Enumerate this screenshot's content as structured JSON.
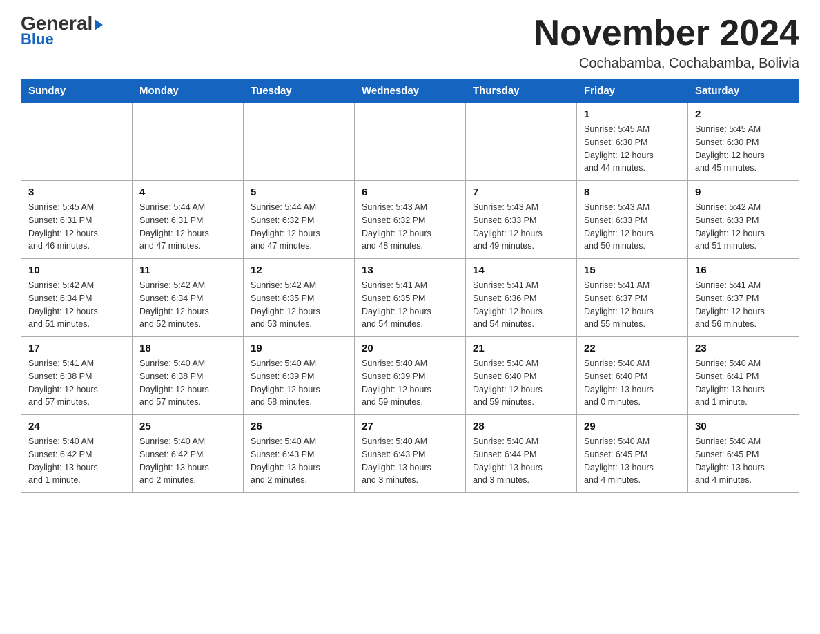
{
  "logo": {
    "general": "General",
    "blue_text": "Blue",
    "triangle": "▶"
  },
  "header": {
    "title": "November 2024",
    "subtitle": "Cochabamba, Cochabamba, Bolivia"
  },
  "weekdays": [
    "Sunday",
    "Monday",
    "Tuesday",
    "Wednesday",
    "Thursday",
    "Friday",
    "Saturday"
  ],
  "weeks": [
    [
      {
        "day": "",
        "info": ""
      },
      {
        "day": "",
        "info": ""
      },
      {
        "day": "",
        "info": ""
      },
      {
        "day": "",
        "info": ""
      },
      {
        "day": "",
        "info": ""
      },
      {
        "day": "1",
        "info": "Sunrise: 5:45 AM\nSunset: 6:30 PM\nDaylight: 12 hours\nand 44 minutes."
      },
      {
        "day": "2",
        "info": "Sunrise: 5:45 AM\nSunset: 6:30 PM\nDaylight: 12 hours\nand 45 minutes."
      }
    ],
    [
      {
        "day": "3",
        "info": "Sunrise: 5:45 AM\nSunset: 6:31 PM\nDaylight: 12 hours\nand 46 minutes."
      },
      {
        "day": "4",
        "info": "Sunrise: 5:44 AM\nSunset: 6:31 PM\nDaylight: 12 hours\nand 47 minutes."
      },
      {
        "day": "5",
        "info": "Sunrise: 5:44 AM\nSunset: 6:32 PM\nDaylight: 12 hours\nand 47 minutes."
      },
      {
        "day": "6",
        "info": "Sunrise: 5:43 AM\nSunset: 6:32 PM\nDaylight: 12 hours\nand 48 minutes."
      },
      {
        "day": "7",
        "info": "Sunrise: 5:43 AM\nSunset: 6:33 PM\nDaylight: 12 hours\nand 49 minutes."
      },
      {
        "day": "8",
        "info": "Sunrise: 5:43 AM\nSunset: 6:33 PM\nDaylight: 12 hours\nand 50 minutes."
      },
      {
        "day": "9",
        "info": "Sunrise: 5:42 AM\nSunset: 6:33 PM\nDaylight: 12 hours\nand 51 minutes."
      }
    ],
    [
      {
        "day": "10",
        "info": "Sunrise: 5:42 AM\nSunset: 6:34 PM\nDaylight: 12 hours\nand 51 minutes."
      },
      {
        "day": "11",
        "info": "Sunrise: 5:42 AM\nSunset: 6:34 PM\nDaylight: 12 hours\nand 52 minutes."
      },
      {
        "day": "12",
        "info": "Sunrise: 5:42 AM\nSunset: 6:35 PM\nDaylight: 12 hours\nand 53 minutes."
      },
      {
        "day": "13",
        "info": "Sunrise: 5:41 AM\nSunset: 6:35 PM\nDaylight: 12 hours\nand 54 minutes."
      },
      {
        "day": "14",
        "info": "Sunrise: 5:41 AM\nSunset: 6:36 PM\nDaylight: 12 hours\nand 54 minutes."
      },
      {
        "day": "15",
        "info": "Sunrise: 5:41 AM\nSunset: 6:37 PM\nDaylight: 12 hours\nand 55 minutes."
      },
      {
        "day": "16",
        "info": "Sunrise: 5:41 AM\nSunset: 6:37 PM\nDaylight: 12 hours\nand 56 minutes."
      }
    ],
    [
      {
        "day": "17",
        "info": "Sunrise: 5:41 AM\nSunset: 6:38 PM\nDaylight: 12 hours\nand 57 minutes."
      },
      {
        "day": "18",
        "info": "Sunrise: 5:40 AM\nSunset: 6:38 PM\nDaylight: 12 hours\nand 57 minutes."
      },
      {
        "day": "19",
        "info": "Sunrise: 5:40 AM\nSunset: 6:39 PM\nDaylight: 12 hours\nand 58 minutes."
      },
      {
        "day": "20",
        "info": "Sunrise: 5:40 AM\nSunset: 6:39 PM\nDaylight: 12 hours\nand 59 minutes."
      },
      {
        "day": "21",
        "info": "Sunrise: 5:40 AM\nSunset: 6:40 PM\nDaylight: 12 hours\nand 59 minutes."
      },
      {
        "day": "22",
        "info": "Sunrise: 5:40 AM\nSunset: 6:40 PM\nDaylight: 13 hours\nand 0 minutes."
      },
      {
        "day": "23",
        "info": "Sunrise: 5:40 AM\nSunset: 6:41 PM\nDaylight: 13 hours\nand 1 minute."
      }
    ],
    [
      {
        "day": "24",
        "info": "Sunrise: 5:40 AM\nSunset: 6:42 PM\nDaylight: 13 hours\nand 1 minute."
      },
      {
        "day": "25",
        "info": "Sunrise: 5:40 AM\nSunset: 6:42 PM\nDaylight: 13 hours\nand 2 minutes."
      },
      {
        "day": "26",
        "info": "Sunrise: 5:40 AM\nSunset: 6:43 PM\nDaylight: 13 hours\nand 2 minutes."
      },
      {
        "day": "27",
        "info": "Sunrise: 5:40 AM\nSunset: 6:43 PM\nDaylight: 13 hours\nand 3 minutes."
      },
      {
        "day": "28",
        "info": "Sunrise: 5:40 AM\nSunset: 6:44 PM\nDaylight: 13 hours\nand 3 minutes."
      },
      {
        "day": "29",
        "info": "Sunrise: 5:40 AM\nSunset: 6:45 PM\nDaylight: 13 hours\nand 4 minutes."
      },
      {
        "day": "30",
        "info": "Sunrise: 5:40 AM\nSunset: 6:45 PM\nDaylight: 13 hours\nand 4 minutes."
      }
    ]
  ]
}
